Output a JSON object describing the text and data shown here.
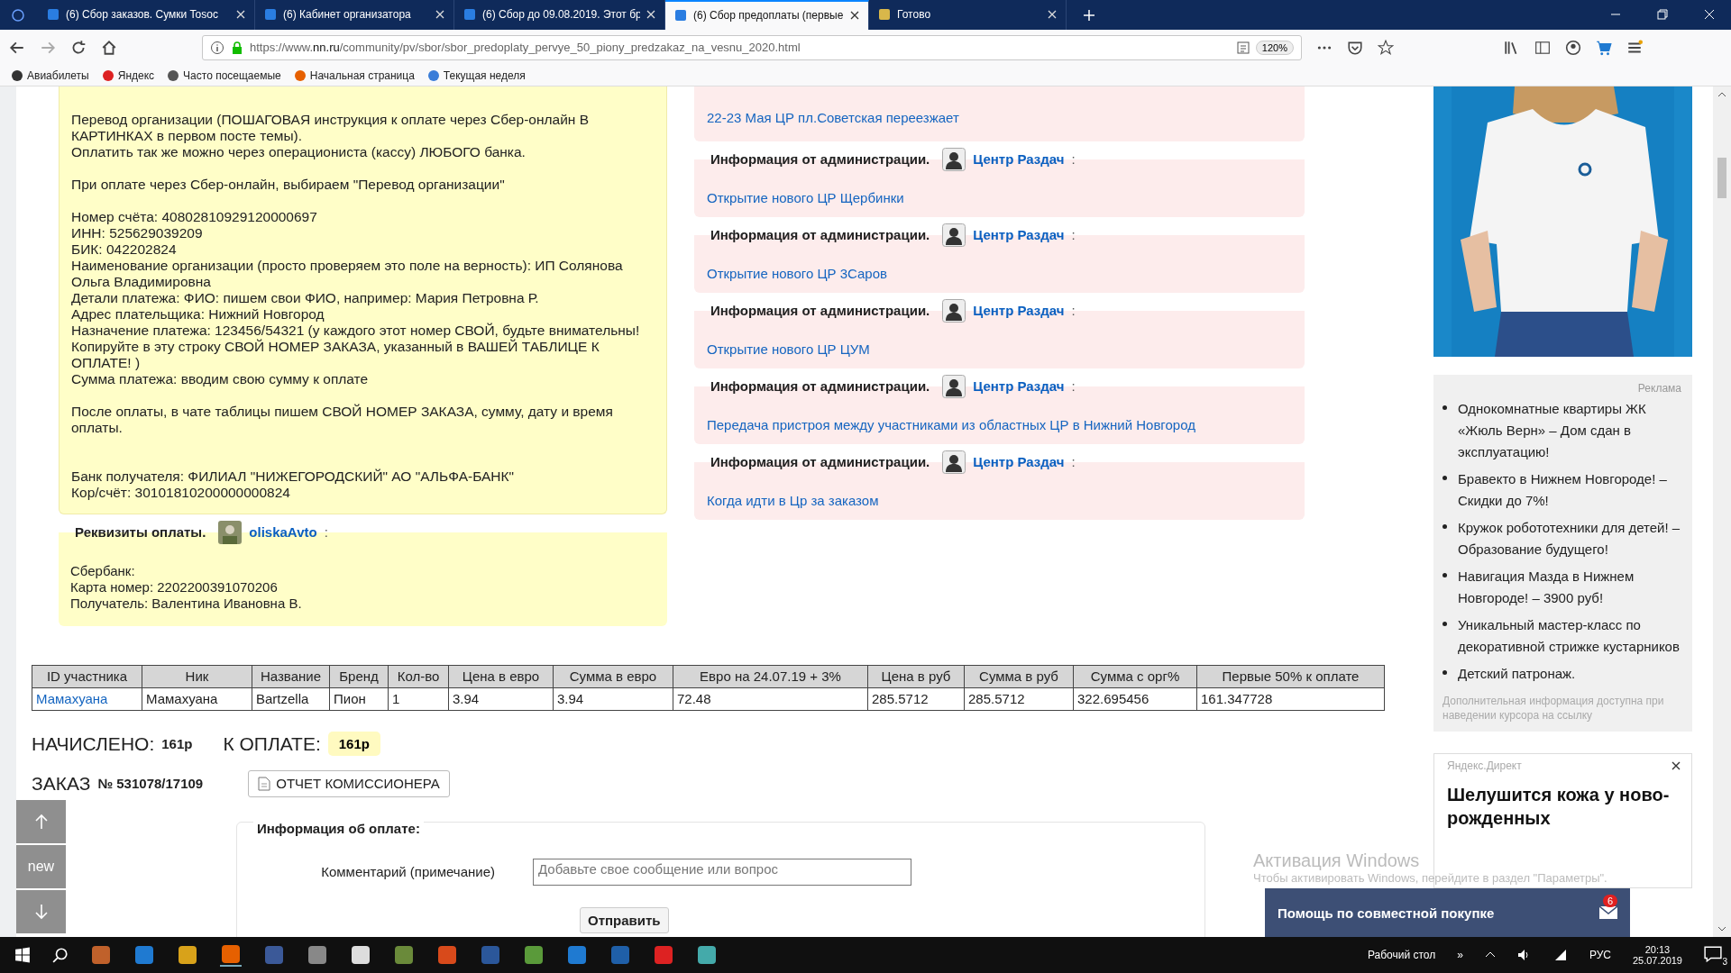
{
  "browser": {
    "tabs": [
      {
        "title": "(6) Сбор заказов. Сумки Tosoc",
        "selected": false
      },
      {
        "title": "(6) Кабинет организатора",
        "selected": false
      },
      {
        "title": "(6) Сбор до 09.08.2019. Этот бр",
        "selected": false
      },
      {
        "title": "(6) Сбор предоплаты (первые",
        "selected": true
      },
      {
        "title": "Готово",
        "selected": false
      }
    ],
    "url": "https://www.**nn.ru**/community/pv/sbor/sbor_predoplaty_pervye_50_piony_predzakaz_na_vesnu_2020.html",
    "zoom": "120%",
    "bookmarks": [
      "Авиабилеты",
      "Яндекс",
      "Часто посещаемые",
      "Начальная страница",
      "Текущая неделя"
    ]
  },
  "requisites_note": {
    "paragraphs": [
      "Перевод организации (ПОШАГОВАЯ инструкция к оплате через Сбер-онлайн В КАРТИНКАХ в первом посте темы).\nОплатить так же можно через операциониста (кассу) ЛЮБОГО банка.",
      "При оплате через Сбер-онлайн, выбираем \"Перевод организации\"",
      "Номер счёта: 40802810929120000697\nИНН: 525629039209\nБИК: 042202824\nНаименование организации (просто проверяем это поле на верность): ИП Солянова Ольга Владимировна\nДетали платежа: ФИО: пишем свои ФИО, например: Мария Петровна Р.\nАдрес плательщика: Нижний Новгород\nНазначение платежа: 123456/54321 (у каждого этот номер СВОЙ, будьте внимательны!\nКопируйте в эту строку СВОЙ НОМЕР ЗАКАЗА, указанный в ВАШЕЙ ТАБЛИЦЕ К ОПЛАТЕ! )\nСумма платежа: вводим свою сумму к оплате",
      "После оплаты, в чате таблицы пишем СВОЙ НОМЕР ЗАКАЗА, сумму, дату и время оплаты.",
      "Банк получателя: ФИЛИАЛ \"НИЖЕГОРОДСКИЙ\" АО \"АЛЬФА-БАНК\"\nКор/счёт: 30101810200000000824"
    ]
  },
  "requisites": {
    "title": "Реквизиты оплаты.",
    "author": "oliskaAvto",
    "separator": ":",
    "text": "Сбербанк:\nКарта номер: 2202200391070206\nПолучатель: Валентина Ивановна В."
  },
  "admin_posts": [
    {
      "link": "22-23 Мая ЦР пл.Советская переезжает"
    },
    {
      "title": "Информация от администрации.",
      "author": "Центр Раздач",
      "separator": ":",
      "link": "Открытие нового ЦР Щербинки"
    },
    {
      "title": "Информация от администрации.",
      "author": "Центр Раздач",
      "separator": ":",
      "link": "Открытие нового ЦР 3Саров"
    },
    {
      "title": "Информация от администрации.",
      "author": "Центр Раздач",
      "separator": ":",
      "link": "Открытие нового ЦР ЦУМ"
    },
    {
      "title": "Информация от администрации.",
      "author": "Центр Раздач",
      "separator": ":",
      "link": "Передача пристроя между участниками из областных ЦР в Нижний Новгород"
    },
    {
      "title": "Информация от администрации.",
      "author": "Центр Раздач",
      "separator": ":",
      "link": "Когда идти в Цр за заказом"
    }
  ],
  "order_table": {
    "columns": [
      "ID участника",
      "Ник",
      "Название",
      "Бренд",
      "Кол-во",
      "Цена в евро",
      "Сумма в евро",
      "Евро на 24.07.19 + 3%",
      "Цена в руб",
      "Сумма в руб",
      "Сумма с орг%",
      "Первые 50% к оплате"
    ],
    "rows": [
      [
        "Мамахуана",
        "Мамахуана",
        "Bartzella",
        "Пион",
        "1",
        "3.94",
        "3.94",
        "72.48",
        "285.5712",
        "285.5712",
        "322.695456",
        "161.347728"
      ]
    ]
  },
  "totals": {
    "accrued_label": "НАЧИСЛЕНО:",
    "accrued": "161р",
    "due_label": "К ОПЛАТЕ:",
    "due": "161р"
  },
  "order": {
    "label": "ЗАКАЗ",
    "number": "№ 531078/17109",
    "report_button": "ОТЧЕТ КОМИССИОНЕРА"
  },
  "payment_form": {
    "title": "Информация об оплате:",
    "comment": {
      "label": "Комментарий (примечание)",
      "placeholder": "Добавьте свое сообщение или вопрос"
    },
    "submit": "Отправить"
  },
  "side_nav": {
    "new_label": "new"
  },
  "sidebar": {
    "ad": {
      "label": "Реклама",
      "items": [
        "Однокомнатные квартиры ЖК «Жюль Верн» – Дом сдан в эксплуатацию!",
        "Бравекто в Нижнем Новгороде! – Скидки до 7%!",
        "Кружок робототехники для детей! – Образование будущего!",
        "Навигация Мазда в Нижнем Новгороде! – 3900 руб!",
        "Уникальный мастер-класс по декоративной стрижке кустарников",
        "Детский патронаж."
      ],
      "note": "Дополнительная информация доступна при наведении курсора на ссылку"
    },
    "direct": {
      "source": "Яндекс.Директ",
      "headline": "Шелушится кожа у ново-\nрожденных"
    }
  },
  "os_notice": {
    "title": "Активация Windows",
    "text": "Чтобы активировать Windows, перейдите в раздел \"Параметры\"."
  },
  "chat": {
    "title": "Помощь по совместной покупке",
    "unread": "6"
  },
  "taskbar": {
    "desktop_label": "Рабочий стол",
    "chevron": "»",
    "language": "РУС",
    "time": "20:13",
    "date": "25.07.2019",
    "notifications": "3"
  }
}
